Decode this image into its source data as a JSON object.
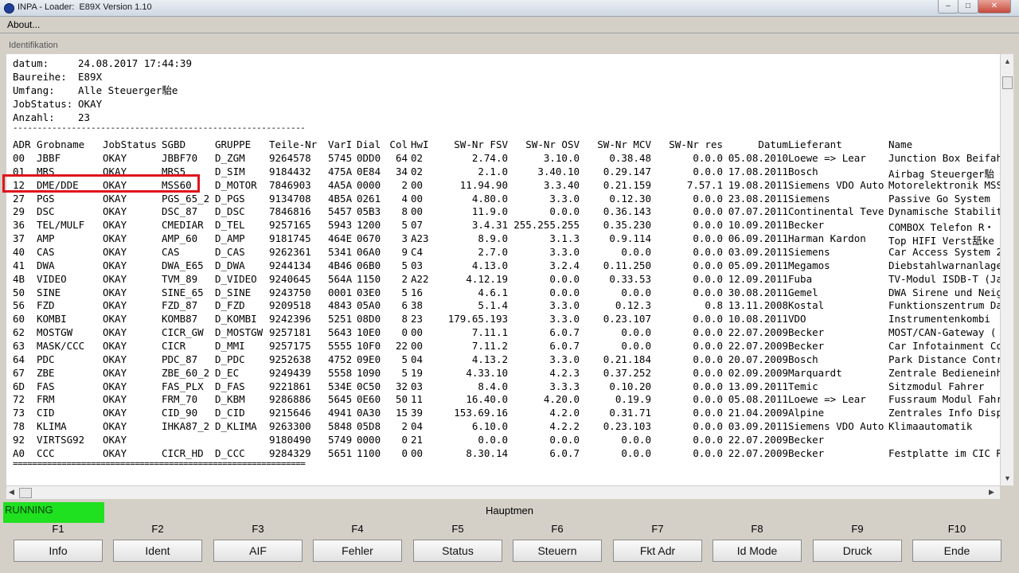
{
  "window": {
    "title": "INPA - Loader:  E89X Version 1.10",
    "minimize": "–",
    "maximize": "□",
    "close": "✕"
  },
  "menu": {
    "about": "About..."
  },
  "panel": {
    "label": "Identifikation"
  },
  "header": [
    {
      "key": "datum:",
      "value": "24.08.2017 17:44:39"
    },
    {
      "key": "Baureihe:",
      "value": "E89X"
    },
    {
      "key": "Umfang:",
      "value": "Alle Steuerger駘e"
    },
    {
      "key": "JobStatus:",
      "value": "OKAY"
    },
    {
      "key": "Anzahl:",
      "value": "23"
    }
  ],
  "separator_top": "------------------------------------------------------------",
  "separator_bottom": "============================================================",
  "table": {
    "columns": [
      "ADR",
      "Grobname",
      "JobStatus",
      "SGBD",
      "GRUPPE",
      "Teile-Nr",
      "VarI",
      "Dial",
      "Col",
      "HwI",
      "SW-Nr FSV",
      "SW-Nr OSV",
      "SW-Nr MCV",
      "SW-Nr res",
      "Datum",
      "Lieferant",
      "Name"
    ],
    "rows": [
      [
        "00",
        "JBBF",
        "OKAY",
        "JBBF70",
        "D_ZGM",
        "9264578",
        "5745",
        "0DD0",
        "64",
        "02",
        "2.74.0",
        "3.10.0",
        "0.38.48",
        "0.0.0",
        "05.08.2010",
        "Loewe => Lear",
        "Junction Box Beifahrer"
      ],
      [
        "01",
        "MRS",
        "OKAY",
        "MRS5",
        "D_SIM",
        "9184432",
        "475A",
        "0E84",
        "34",
        "02",
        "2.1.0",
        "3.40.10",
        "0.29.147",
        "0.0.0",
        "17.08.2011",
        "Bosch",
        "Airbag Steuerger駘"
      ],
      [
        "12",
        "DME/DDE",
        "OKAY",
        "MSS60",
        "D_MOTOR",
        "7846903",
        "4A5A",
        "0000",
        "2",
        "00",
        "11.94.90",
        "3.3.40",
        "0.21.159",
        "7.57.1",
        "19.08.2011",
        "Siemens VDO Auto",
        "Motorelektronik MSS60"
      ],
      [
        "27",
        "PGS",
        "OKAY",
        "PGS_65_2",
        "D_PGS",
        "9134708",
        "4B5A",
        "0261",
        "4",
        "00",
        "4.80.0",
        "3.3.0",
        "0.12.30",
        "0.0.0",
        "23.08.2011",
        "Siemens",
        "Passive Go System"
      ],
      [
        "29",
        "DSC",
        "OKAY",
        "DSC_87",
        "D_DSC",
        "7846816",
        "5457",
        "05B3",
        "8",
        "00",
        "11.9.0",
        "0.0.0",
        "0.36.143",
        "0.0.0",
        "07.07.2011",
        "Continental Teve",
        "Dynamische Stabilit"
      ],
      [
        "36",
        "TEL/MULF",
        "OKAY",
        "CMEDIAR",
        "D_TEL",
        "9257165",
        "5943",
        "1200",
        "5",
        "07",
        "3.4.31",
        "255.255.255",
        "0.35.230",
        "0.0.0",
        "10.09.2011",
        "Becker",
        "COMBOX Telefon R・"
      ],
      [
        "37",
        "AMP",
        "OKAY",
        "AMP_60",
        "D_AMP",
        "9181745",
        "464E",
        "0670",
        "3",
        "A23",
        "8.9.0",
        "3.1.3",
        "0.9.114",
        "0.0.0",
        "06.09.2011",
        "Harman Kardon",
        "Top HIFI Verst舐ke"
      ],
      [
        "40",
        "CAS",
        "OKAY",
        "CAS",
        "D_CAS",
        "9262361",
        "5341",
        "06A0",
        "9",
        "C4",
        "2.7.0",
        "3.3.0",
        "0.0.0",
        "0.0.0",
        "03.09.2011",
        "Siemens",
        "Car Access System 2"
      ],
      [
        "41",
        "DWA",
        "OKAY",
        "DWA_E65",
        "D_DWA",
        "9244134",
        "4B46",
        "06B0",
        "5",
        "03",
        "4.13.0",
        "3.2.4",
        "0.11.250",
        "0.0.0",
        "05.09.2011",
        "Megamos",
        "Diebstahlwarnanlage"
      ],
      [
        "4B",
        "VIDEO",
        "OKAY",
        "TVM_89",
        "D_VIDEO",
        "9240645",
        "564A",
        "1150",
        "2",
        "A22",
        "4.12.19",
        "0.0.0",
        "0.33.53",
        "0.0.0",
        "12.09.2011",
        "Fuba",
        "TV-Modul ISDB-T (Ja"
      ],
      [
        "50",
        "SINE",
        "OKAY",
        "SINE_65",
        "D_SINE",
        "9243750",
        "0001",
        "03E0",
        "5",
        "16",
        "4.6.1",
        "0.0.0",
        "0.0.0",
        "0.0.0",
        "30.08.2011",
        "Gemel",
        "DWA Sirene und Neig"
      ],
      [
        "56",
        "FZD",
        "OKAY",
        "FZD_87",
        "D_FZD",
        "9209518",
        "4843",
        "05A0",
        "6",
        "38",
        "5.1.4",
        "3.3.0",
        "0.12.3",
        "0.8",
        "13.11.2008",
        "Kostal",
        "Funktionszentrum Da"
      ],
      [
        "60",
        "KOMBI",
        "OKAY",
        "KOMB87",
        "D_KOMBI",
        "9242396",
        "5251",
        "08D0",
        "8",
        "23",
        "179.65.193",
        "3.3.0",
        "0.23.107",
        "0.0.0",
        "10.08.2011",
        "VDO",
        "Instrumentenkombi"
      ],
      [
        "62",
        "MOSTGW",
        "OKAY",
        "CICR_GW",
        "D_MOSTGW",
        "9257181",
        "5643",
        "10E0",
        "0",
        "00",
        "7.11.1",
        "6.0.7",
        "0.0.0",
        "0.0.0",
        "22.07.2009",
        "Becker",
        "MOST/CAN-Gateway ("
      ],
      [
        "63",
        "MASK/CCC",
        "OKAY",
        "CICR",
        "D_MMI",
        "9257175",
        "5555",
        "10F0",
        "22",
        "00",
        "7.11.2",
        "6.0.7",
        "0.0.0",
        "0.0.0",
        "22.07.2009",
        "Becker",
        "Car Infotainment Co"
      ],
      [
        "64",
        "PDC",
        "OKAY",
        "PDC_87",
        "D_PDC",
        "9252638",
        "4752",
        "09E0",
        "5",
        "04",
        "4.13.2",
        "3.3.0",
        "0.21.184",
        "0.0.0",
        "20.07.2009",
        "Bosch",
        "Park Distance Contr"
      ],
      [
        "67",
        "ZBE",
        "OKAY",
        "ZBE_60_2",
        "D_EC",
        "9249439",
        "5558",
        "1090",
        "5",
        "19",
        "4.33.10",
        "4.2.3",
        "0.37.252",
        "0.0.0",
        "02.09.2009",
        "Marquardt",
        "Zentrale Bedieneinh"
      ],
      [
        "6D",
        "FAS",
        "OKAY",
        "FAS_PLX",
        "D_FAS",
        "9221861",
        "534E",
        "0C50",
        "32",
        "03",
        "8.4.0",
        "3.3.3",
        "0.10.20",
        "0.0.0",
        "13.09.2011",
        "Temic",
        "Sitzmodul Fahrer"
      ],
      [
        "72",
        "FRM",
        "OKAY",
        "FRM_70",
        "D_KBM",
        "9286886",
        "5645",
        "0E60",
        "50",
        "11",
        "16.40.0",
        "4.20.0",
        "0.19.9",
        "0.0.0",
        "05.08.2011",
        "Loewe => Lear",
        "Fussraum Modul Fahr"
      ],
      [
        "73",
        "CID",
        "OKAY",
        "CID_90",
        "D_CID",
        "9215646",
        "4941",
        "0A30",
        "15",
        "39",
        "153.69.16",
        "4.2.0",
        "0.31.71",
        "0.0.0",
        "21.04.2009",
        "Alpine",
        "Zentrales Info Disp"
      ],
      [
        "78",
        "KLIMA",
        "OKAY",
        "IHKA87_2",
        "D_KLIMA",
        "9263300",
        "5848",
        "05D8",
        "2",
        "04",
        "6.10.0",
        "4.2.2",
        "0.23.103",
        "0.0.0",
        "03.09.2011",
        "Siemens VDO Auto",
        "Klimaautomatik"
      ],
      [
        "92",
        "VIRTSG92",
        "OKAY",
        "",
        "",
        "9180490",
        "5749",
        "0000",
        "0",
        "21",
        "0.0.0",
        "0.0.0",
        "0.0.0",
        "0.0.0",
        "22.07.2009",
        "Becker",
        ""
      ],
      [
        "A0",
        "CCC",
        "OKAY",
        "CICR_HD",
        "D_CCC",
        "9284329",
        "5651",
        "1100",
        "0",
        "00",
        "8.30.14",
        "6.0.7",
        "0.0.0",
        "0.0.0",
        "22.07.2009",
        "Becker",
        "Festplatte im CIC R"
      ]
    ]
  },
  "status": {
    "running": "RUNNING",
    "title": "Hauptmen"
  },
  "fkeys": [
    {
      "key": "F1",
      "label": "Info"
    },
    {
      "key": "F2",
      "label": "Ident"
    },
    {
      "key": "F3",
      "label": "AIF"
    },
    {
      "key": "F4",
      "label": "Fehler"
    },
    {
      "key": "F5",
      "label": "Status"
    },
    {
      "key": "F6",
      "label": "Steuern"
    },
    {
      "key": "F7",
      "label": "Fkt Adr"
    },
    {
      "key": "F8",
      "label": "Id Mode"
    },
    {
      "key": "F9",
      "label": "Druck"
    },
    {
      "key": "F10",
      "label": "Ende"
    }
  ],
  "colors": {
    "running_bg": "#1fe11f",
    "highlight_border": "#e0141b"
  }
}
